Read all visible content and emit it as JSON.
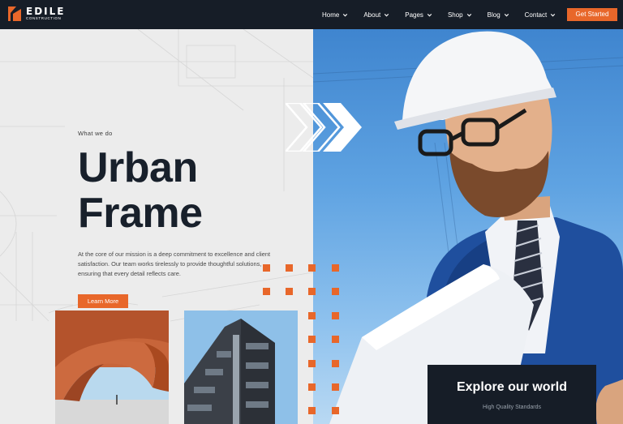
{
  "brand": {
    "name": "EDILE",
    "tagline": "CONSTRUCTION"
  },
  "nav": {
    "items": [
      {
        "label": "Home",
        "icon": "chevron-down-icon"
      },
      {
        "label": "About",
        "icon": "chevron-down-icon"
      },
      {
        "label": "Pages",
        "icon": "chevron-down-icon"
      },
      {
        "label": "Shop",
        "icon": "chevron-down-icon"
      },
      {
        "label": "Blog",
        "icon": "chevron-down-icon"
      },
      {
        "label": "Contact",
        "icon": "chevron-down-icon"
      }
    ],
    "cta_label": "Get Started"
  },
  "hero": {
    "eyebrow": "What we do",
    "title_line1": "Urban",
    "title_line2": "Frame",
    "description": "At the core of our mission is a deep commitment to excellence and client satisfaction. Our team works tirelessly to provide thoughtful solutions, ensuring that every detail reflects care.",
    "button_label": "Learn More"
  },
  "explore": {
    "title": "Explore our world",
    "subtitle": "High Quality Standards"
  },
  "colors": {
    "accent": "#e8672a",
    "dark": "#161d27",
    "heading": "#18202b",
    "sky": "#5fa3e2"
  }
}
